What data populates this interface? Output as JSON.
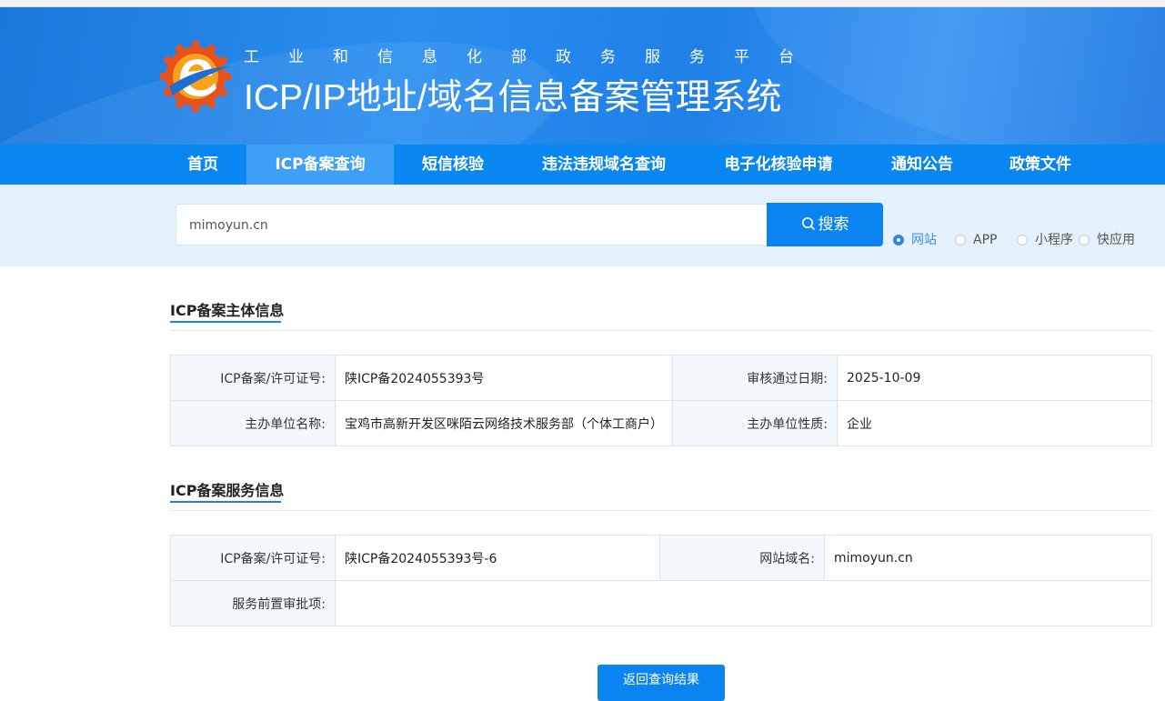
{
  "header": {
    "subtitle": "工业和信息化部政务服务平台",
    "title": "ICP/IP地址/域名信息备案管理系统"
  },
  "nav": {
    "items": [
      {
        "label": "首页"
      },
      {
        "label": "ICP备案查询",
        "active": true
      },
      {
        "label": "短信核验"
      },
      {
        "label": "违法违规域名查询"
      },
      {
        "label": "电子化核验申请"
      },
      {
        "label": "通知公告"
      },
      {
        "label": "政策文件"
      }
    ]
  },
  "search": {
    "value": "mimoyun.cn",
    "button_label": "搜索",
    "types": [
      {
        "label": "网站",
        "checked": true
      },
      {
        "label": "APP",
        "checked": false
      },
      {
        "label": "小程序",
        "checked": false
      },
      {
        "label": "快应用",
        "checked": false
      }
    ]
  },
  "subject_info": {
    "title": "ICP备案主体信息",
    "rows": [
      {
        "label1": "ICP备案/许可证号:",
        "value1": "陕ICP备2024055393号",
        "label2": "审核通过日期:",
        "value2": "2025-10-09"
      },
      {
        "label1": "主办单位名称:",
        "value1": "宝鸡市高新开发区咪陌云网络技术服务部（个体工商户）",
        "label2": "主办单位性质:",
        "value2": "企业"
      }
    ]
  },
  "service_info": {
    "title": "ICP备案服务信息",
    "rows": [
      {
        "label1": "ICP备案/许可证号:",
        "value1": "陕ICP备2024055393号-6",
        "label2": "网站域名:",
        "value2": "mimoyun.cn"
      },
      {
        "label1": "服务前置审批项:",
        "value1": ""
      }
    ]
  },
  "back_button_label": "返回查询结果",
  "colors": {
    "primary": "#0a86f2",
    "header_blue": "#1f80e8",
    "search_band": "#e5f1fc",
    "label_bg": "#f3f8fd"
  }
}
